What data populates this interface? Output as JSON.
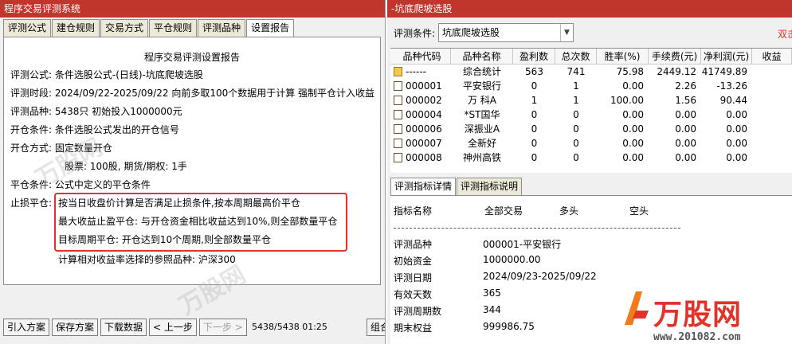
{
  "left": {
    "title": "程序交易评测系统",
    "tabs": [
      "评测公式",
      "建仓规则",
      "交易方式",
      "平仓规则",
      "评测品种",
      "设置报告"
    ],
    "active_tab": 5,
    "report": {
      "title": "程序交易评测设置报告",
      "lines": [
        "评测公式:  条件选股公式-(日线)-坑底爬坡选股",
        "评测时段:  2024/09/22-2025/09/22 向前多取100个数据用于计算 强制平仓计入收益",
        "评测品种:  5438只 初始投入1000000元",
        "开仓条件:  条件选股公式发出的开仓信号",
        "开仓方式:  固定数量开仓",
        "股票: 100股, 期货/期权: 1手",
        "平仓条件:  公式中定义的平仓条件",
        "止损平仓:",
        "按当日收盘价计算是否满足止损条件,按本周期最高价平仓",
        "最大收益止盈平仓:  与开仓资金相比收益达到10%,则全部数量平仓",
        "目标周期平仓:  开仓达到10个周期,则全部数量平仓",
        "计算相对收益率选择的参照品种:  沪深300"
      ]
    },
    "buttons": [
      "引入方案",
      "保存方案",
      "下载数据",
      "< 上一步",
      "下一步 >"
    ],
    "status": "5438/5438  01:25",
    "right_cut_button": "组合"
  },
  "right": {
    "title": "-坑底爬坡选股",
    "cond_label": "评测条件:",
    "cond_value": "坑底爬坡选股",
    "red_label": "双击",
    "columns": [
      "品种代码",
      "品种名称",
      "盈利数",
      "总次数",
      "胜率(%)",
      "手续费(元)",
      "净利润(元)",
      "收益"
    ],
    "rows": [
      {
        "code": "------",
        "name": "综合统计",
        "win": "563",
        "total": "741",
        "rate": "75.98",
        "fee": "2449.12",
        "profit": "41749.89",
        "icon": "folder"
      },
      {
        "code": "000001",
        "name": "平安银行",
        "win": "0",
        "total": "1",
        "rate": "0.00",
        "fee": "2.26",
        "profit": "-13.26",
        "icon": "doc"
      },
      {
        "code": "000002",
        "name": "万 科A",
        "win": "1",
        "total": "1",
        "rate": "100.00",
        "fee": "1.56",
        "profit": "90.44",
        "icon": "doc"
      },
      {
        "code": "000004",
        "name": "*ST国华",
        "win": "0",
        "total": "0",
        "rate": "0.00",
        "fee": "0.00",
        "profit": "0.00",
        "icon": "doc"
      },
      {
        "code": "000006",
        "name": "深振业A",
        "win": "0",
        "total": "0",
        "rate": "0.00",
        "fee": "0.00",
        "profit": "0.00",
        "icon": "doc"
      },
      {
        "code": "000007",
        "name": "全新好",
        "win": "0",
        "total": "0",
        "rate": "0.00",
        "fee": "0.00",
        "profit": "0.00",
        "icon": "doc"
      },
      {
        "code": "000008",
        "name": "神州高铁",
        "win": "0",
        "total": "0",
        "rate": "0.00",
        "fee": "0.00",
        "profit": "0.00",
        "icon": "doc"
      }
    ],
    "tabs": [
      "评测指标详情",
      "评测指标说明"
    ],
    "detail": {
      "headers": [
        "指标名称",
        "全部交易",
        "多头",
        "空头"
      ],
      "items": [
        {
          "k": "评测品种",
          "v": "000001-平安银行"
        },
        {
          "k": "初始资金",
          "v": "1000000.00"
        },
        {
          "k": "评测日期",
          "v": "2024/09/23-2025/09/22"
        },
        {
          "k": "有效天数",
          "v": "365"
        },
        {
          "k": "评测周期数",
          "v": "344"
        },
        {
          "k": "期末权益",
          "v": "999986.75"
        }
      ]
    },
    "logo": {
      "text": "万股网",
      "url": "www.201082.com"
    }
  },
  "watermark": "万股网"
}
